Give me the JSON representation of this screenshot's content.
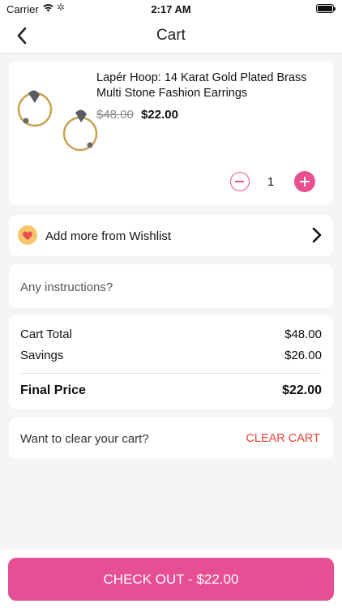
{
  "status_bar": {
    "carrier": "Carrier",
    "time": "2:17 AM"
  },
  "nav": {
    "title": "Cart"
  },
  "product": {
    "name": "Lapér Hoop: 14 Karat Gold Plated Brass Multi Stone Fashion Earrings",
    "original_price": "$48.00",
    "sale_price": "$22.00",
    "quantity": "1"
  },
  "wishlist": {
    "label": "Add more from Wishlist"
  },
  "instructions": {
    "placeholder": "Any instructions?"
  },
  "summary": {
    "cart_total_label": "Cart Total",
    "cart_total_value": "$48.00",
    "savings_label": "Savings",
    "savings_value": "$26.00",
    "final_price_label": "Final Price",
    "final_price_value": "$22.00"
  },
  "clear_cart": {
    "prompt": "Want to clear your cart?",
    "button_label": "CLEAR CART"
  },
  "checkout": {
    "button_label": "CHECK OUT - $22.00"
  },
  "colors": {
    "accent": "#e64f93",
    "clear_red": "#e8443a",
    "wishlist_icon_bg": "#f6c66a"
  }
}
